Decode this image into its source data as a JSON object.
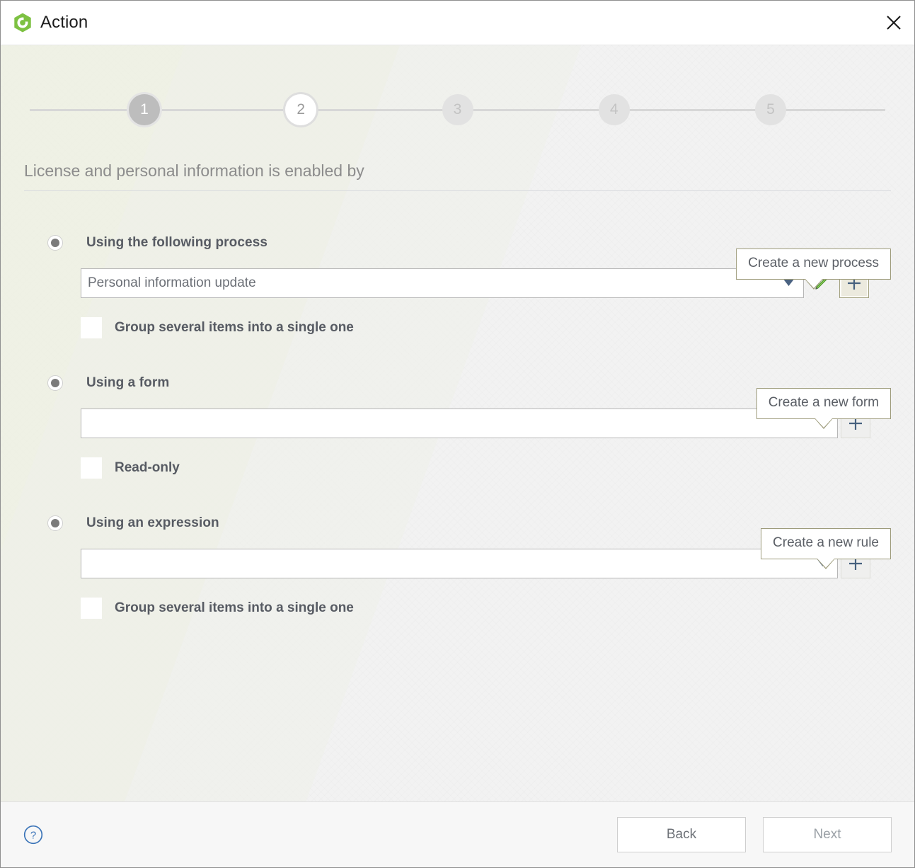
{
  "window": {
    "title": "Action",
    "logo_icon": "green-hexagon-logo",
    "close_icon": "close-icon"
  },
  "stepper": {
    "steps": [
      {
        "number": "1",
        "state": "done"
      },
      {
        "number": "2",
        "state": "current"
      },
      {
        "number": "3",
        "state": "todo"
      },
      {
        "number": "4",
        "state": "todo"
      },
      {
        "number": "5",
        "state": "todo"
      }
    ]
  },
  "section": {
    "title": "License and personal information is enabled by"
  },
  "options": [
    {
      "id": "process",
      "radio_label": "Using the following process",
      "radio_selected": true,
      "callout": "Create a new process",
      "combo_value": "Personal information update",
      "combo_placeholder": "",
      "has_edit_button": true,
      "edit_icon": "pencil-icon",
      "add_icon": "plus-icon",
      "add_button_state": "hover",
      "caret_icon": "chevron-down-icon",
      "checkbox_label": "Group several items into a single one",
      "checkbox_checked": false
    },
    {
      "id": "form",
      "radio_label": "Using a form",
      "radio_selected": true,
      "callout": "Create a new form",
      "combo_value": "",
      "combo_placeholder": "",
      "has_edit_button": false,
      "edit_icon": "",
      "add_icon": "plus-icon",
      "add_button_state": "normal",
      "caret_icon": "chevron-down-icon",
      "checkbox_label": "Read-only",
      "checkbox_checked": false
    },
    {
      "id": "expression",
      "radio_label": "Using an expression",
      "radio_selected": true,
      "callout": "Create a new rule",
      "combo_value": "",
      "combo_placeholder": "",
      "has_edit_button": false,
      "edit_icon": "",
      "add_icon": "plus-icon",
      "add_button_state": "normal",
      "caret_icon": "chevron-down-icon",
      "checkbox_label": "Group several items into a single one",
      "checkbox_checked": false
    }
  ],
  "footer": {
    "help_icon": "help-circle-icon",
    "back_label": "Back",
    "next_label": "Next"
  },
  "colors": {
    "brand_green": "#7dc142",
    "callout_border": "#9e9c7c",
    "text_strong": "#575b63",
    "text_muted": "#8c8c8c",
    "step_done": "#bdbdbd",
    "help_blue": "#3b74b8"
  }
}
